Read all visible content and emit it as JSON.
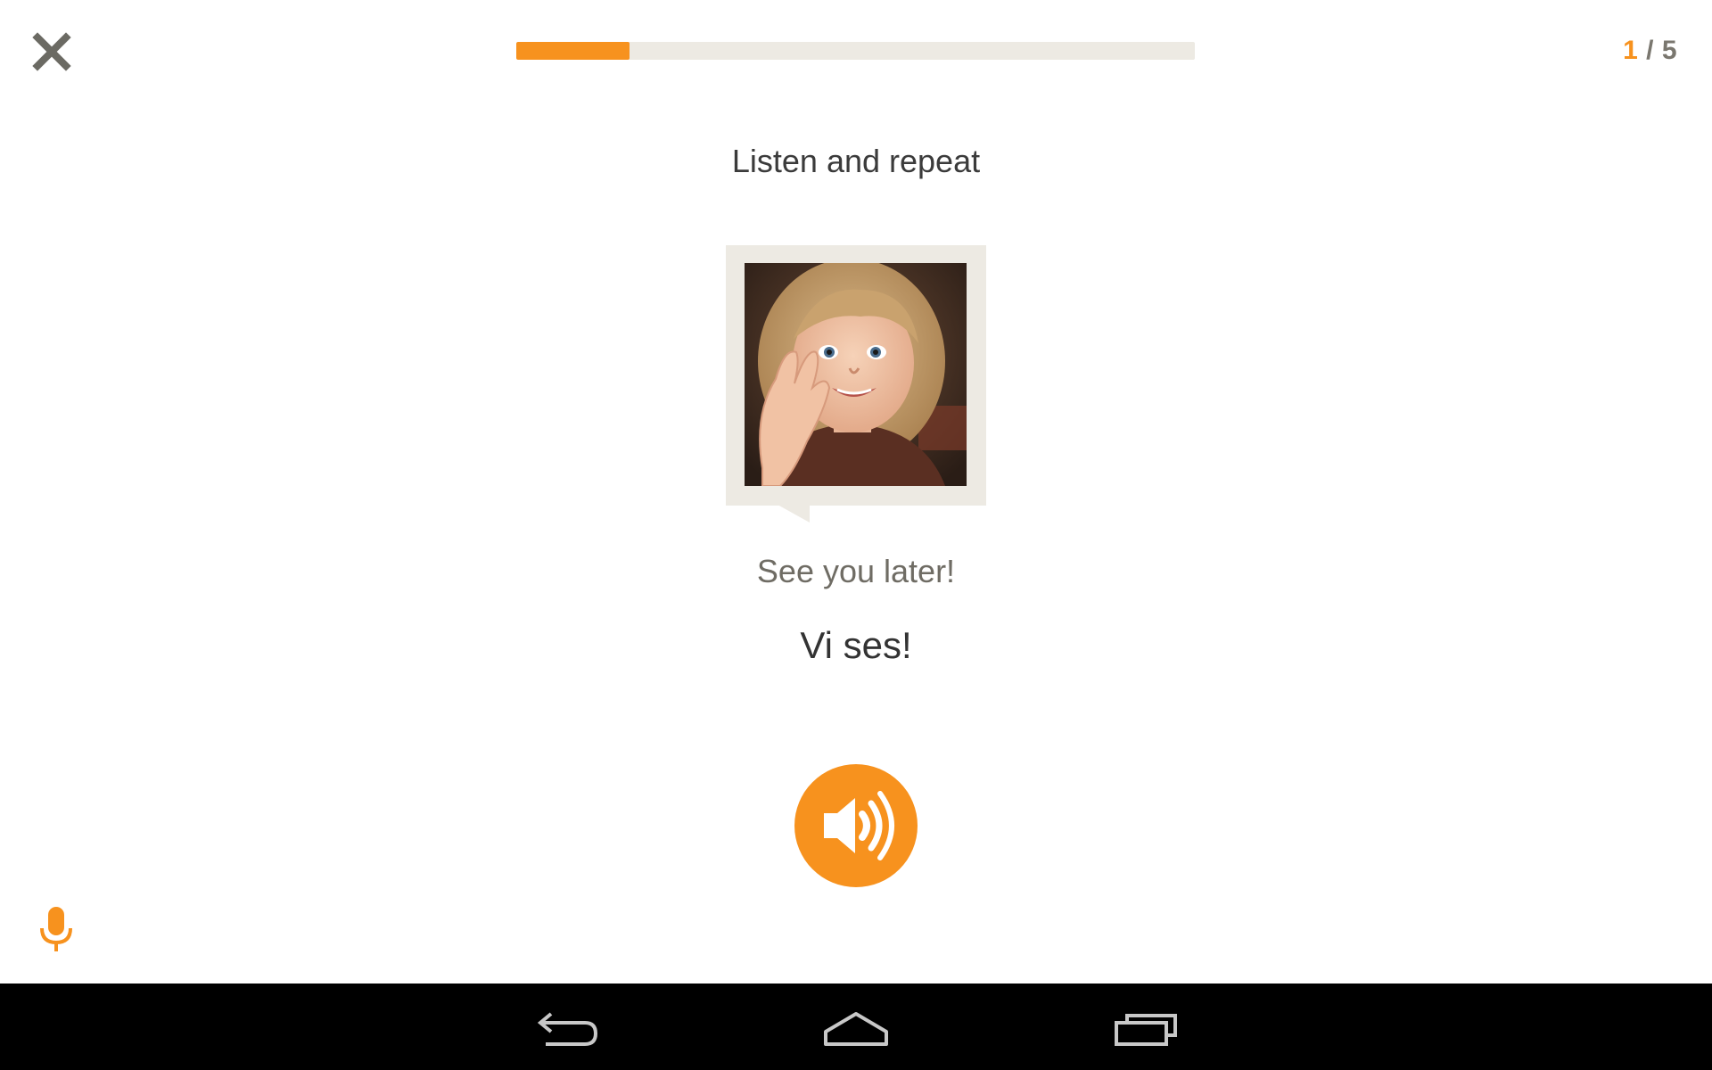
{
  "header": {
    "close_icon": "close-icon",
    "progress": {
      "fraction": 0.167,
      "fill_color": "#f7921e",
      "track_color": "#edeae3"
    },
    "counter": {
      "current": "1",
      "separator": " / ",
      "total": "5"
    }
  },
  "lesson": {
    "instruction": "Listen and repeat",
    "image": "photo of a smiling child waving",
    "translation": "See you later!",
    "phrase": "Vi ses!",
    "play_audio_icon": "speaker-icon"
  },
  "footer": {
    "mic_icon": "microphone-icon"
  },
  "system_nav": {
    "back_icon": "back-icon",
    "home_icon": "home-icon",
    "recents_icon": "recents-icon"
  },
  "colors": {
    "accent": "#f7921e",
    "muted_text": "#7a776f",
    "card_bg": "#edeae3"
  }
}
